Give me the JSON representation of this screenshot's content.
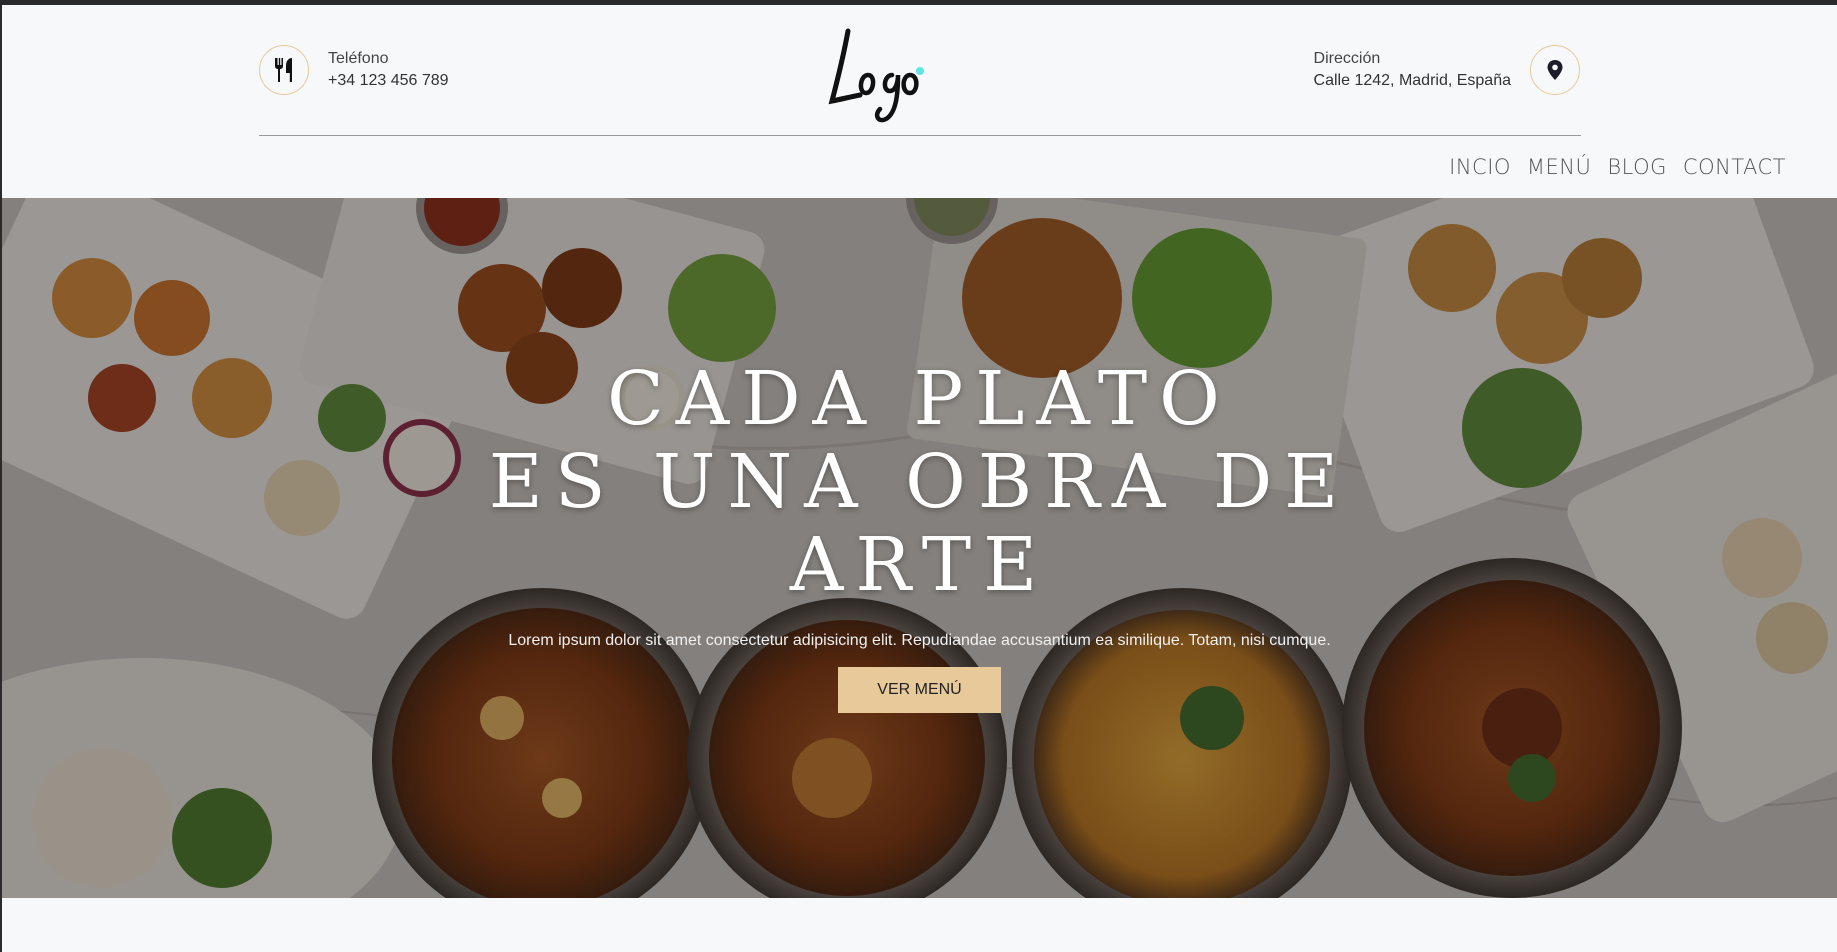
{
  "header": {
    "phone": {
      "label": "Teléfono",
      "value": "+34 123 456 789",
      "icon": "cutlery-icon"
    },
    "address": {
      "label": "Dirección",
      "value": "Calle 1242, Madrid, España",
      "icon": "map-pin-icon"
    },
    "logo_text": "Logo",
    "accent_color": "#e6c999",
    "logo_dot_color": "#5ee6e0"
  },
  "nav": {
    "items": [
      "INCIO",
      "MENÚ",
      "BLOG",
      "CONTACT"
    ]
  },
  "hero": {
    "title_lines": [
      "CADA PLATO",
      "ES UNA OBRA DE",
      "ARTE"
    ],
    "text": "Lorem ipsum dolor sit amet consectetur adipisicing elit. Repudiandae accusantium ea similique. Totam, nisi cumque.",
    "button_label": "VER MENÚ",
    "button_color": "#e8ca9a"
  }
}
